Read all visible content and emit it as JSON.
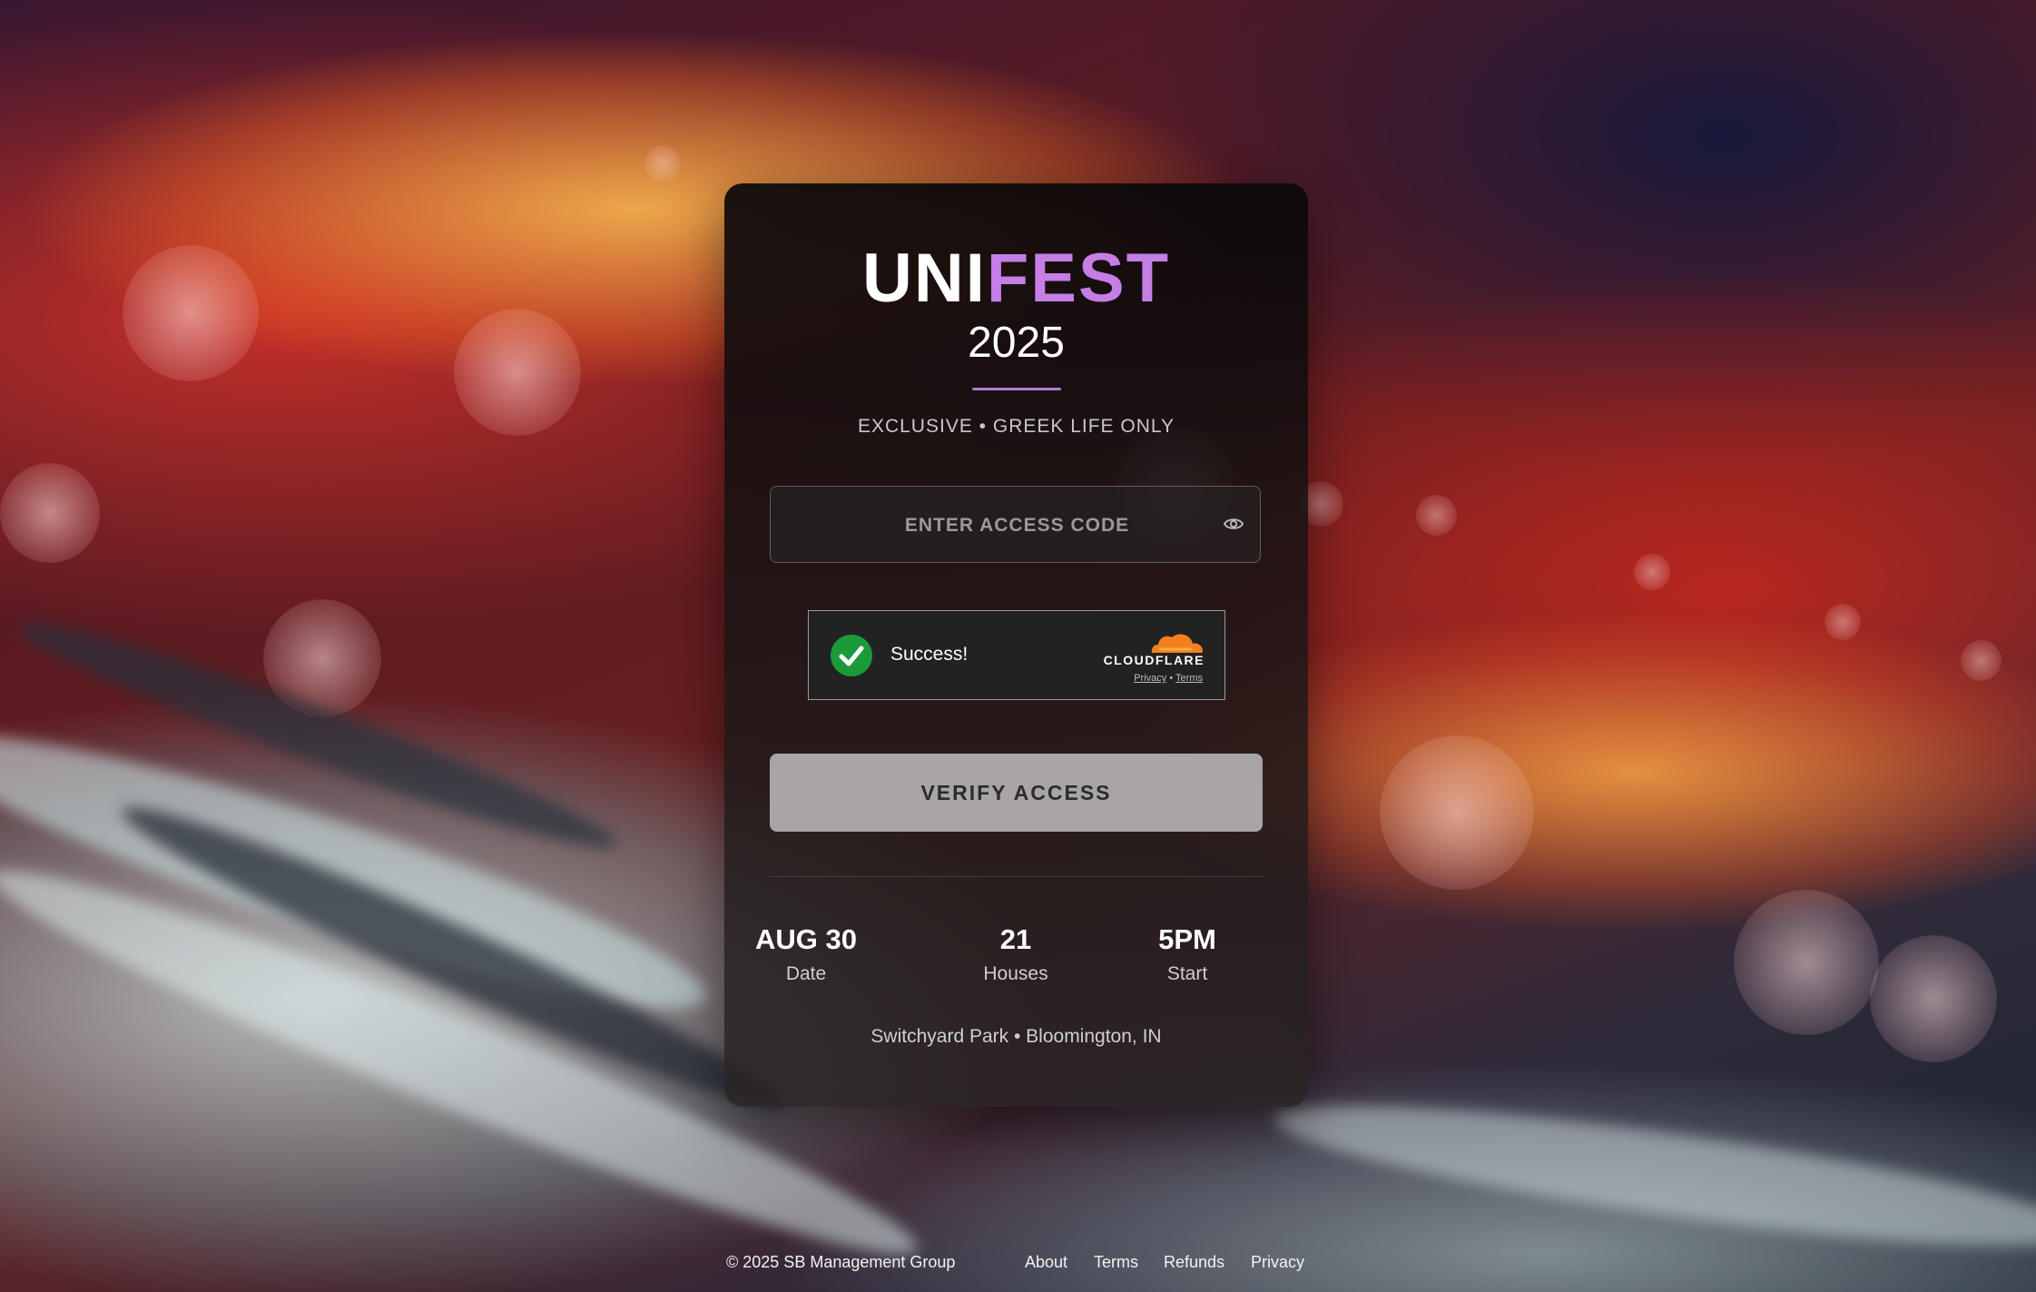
{
  "brand": {
    "name_part1": "UNI",
    "name_part2": "FEST",
    "year": "2025",
    "tagline": "EXCLUSIVE • GREEK LIFE ONLY",
    "accent_color": "#c57ee6"
  },
  "access_form": {
    "placeholder": "ENTER ACCESS CODE",
    "value": "",
    "visibility_icon": "eye-icon",
    "verify_label": "VERIFY ACCESS"
  },
  "captcha": {
    "status": "Success!",
    "provider": "CLOUDFLARE",
    "privacy_link": "Privacy",
    "separator": "•",
    "terms_link": "Terms",
    "status_icon": "check-circle-icon",
    "status_color": "#1c9a3a"
  },
  "event_stats": [
    {
      "value": "AUG 30",
      "label": "Date"
    },
    {
      "value": "21",
      "label": "Houses"
    },
    {
      "value": "5PM",
      "label": "Start"
    }
  ],
  "venue": "Switchyard Park • Bloomington, IN",
  "footer": {
    "copyright": "© 2025 SB Management Group",
    "links": [
      "About",
      "Terms",
      "Refunds",
      "Privacy"
    ]
  }
}
